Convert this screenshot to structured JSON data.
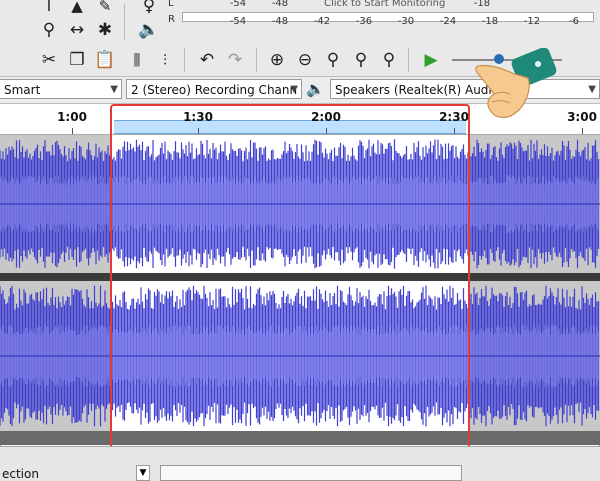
{
  "meter": {
    "hint": "Click to Start Monitoring",
    "ticks": [
      "-54",
      "-48",
      "-42",
      "-36",
      "-30",
      "-24",
      "-18",
      "-12",
      "-6"
    ],
    "left_label": "L",
    "right_label": "R"
  },
  "device": {
    "host": "Smart",
    "channels": "2 (Stereo) Recording Chann",
    "output": "Speakers (Realtek(R) Audio"
  },
  "timeline": {
    "labels": [
      "1:00",
      "1:30",
      "2:00",
      "2:30",
      "3:00"
    ]
  },
  "bottom": {
    "section_label": "ection"
  },
  "colors": {
    "wave": "#3f3fd0",
    "wave_sel": "#3a3ad6",
    "sel_bg": "#ffffff",
    "unsel_bg": "#c8c8c8",
    "highlight": "#e53935"
  },
  "icons": [
    "cursor-tool-icon",
    "envelope-tool-icon",
    "draw-tool-icon",
    "zoom-tool-icon",
    "timeshift-tool-icon",
    "multi-tool-icon",
    "cut-icon",
    "copy-icon",
    "paste-icon",
    "trim-icon",
    "silence-icon",
    "undo-icon",
    "redo-icon",
    "zoom-in-icon",
    "zoom-out-icon",
    "fit-selection-icon",
    "fit-project-icon",
    "zoom-toggle-icon",
    "play-icon",
    "speaker-icon"
  ]
}
